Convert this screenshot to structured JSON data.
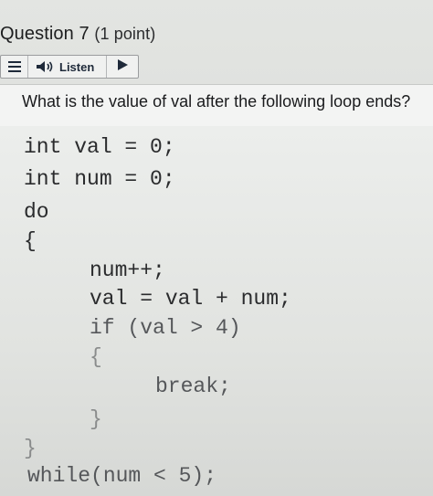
{
  "question": {
    "title": "Question 7",
    "points": "(1 point)"
  },
  "listen_bar": {
    "menu_icon": "menu-icon",
    "speaker_icon": "speaker-icon",
    "listen_label": "Listen",
    "play_icon": "play-icon"
  },
  "prompt": "What is the value of val after the following loop ends?",
  "code_lines": [
    "int val = 0;",
    "int num = 0;",
    "do",
    "{",
    "num++;",
    "val = val + num;",
    "if (val > 4)",
    "{",
    "break;",
    "}",
    "}",
    "while(num < 5);"
  ]
}
